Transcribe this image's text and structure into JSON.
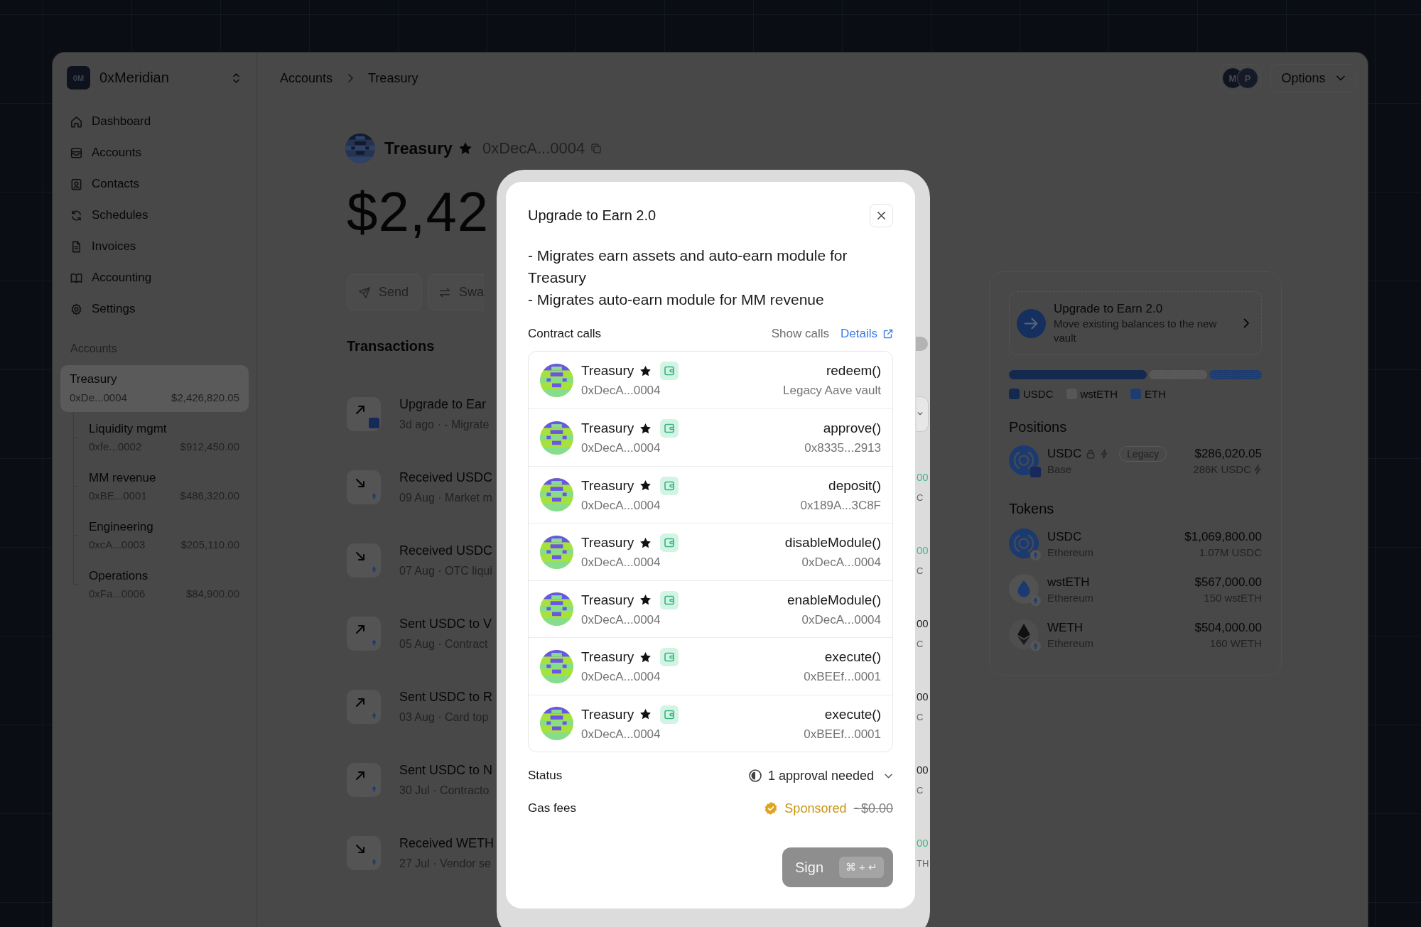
{
  "sidebar": {
    "logo": "0M",
    "org_name": "0xMeridian",
    "nav": [
      {
        "label": "Dashboard"
      },
      {
        "label": "Accounts"
      },
      {
        "label": "Contacts"
      },
      {
        "label": "Schedules"
      },
      {
        "label": "Invoices"
      },
      {
        "label": "Accounting"
      },
      {
        "label": "Settings"
      }
    ],
    "section_label": "Accounts",
    "accounts": [
      {
        "name": "Treasury",
        "address": "0xDe...0004",
        "balance": "$2,426,820.05",
        "selected": true,
        "children": [
          {
            "name": "Liquidity mgmt",
            "address": "0xfe...0002",
            "balance": "$912,450.00",
            "selected": false
          },
          {
            "name": "MM revenue",
            "address": "0xBE...0001",
            "balance": "$486,320.00",
            "selected": false
          },
          {
            "name": "Engineering",
            "address": "0xcA...0003",
            "balance": "$205,110.00",
            "selected": false
          },
          {
            "name": "Operations",
            "address": "0xFa...0006",
            "balance": "$84,900.00",
            "selected": false
          }
        ]
      }
    ]
  },
  "topbar": {
    "breadcrumbs": [
      "Accounts",
      "Treasury"
    ],
    "avatars": [
      "M",
      "P"
    ],
    "options": "Options"
  },
  "account": {
    "name": "Treasury",
    "starred": true,
    "address": "0xDecA...0004",
    "balance": "$2,42",
    "actions": [
      "Send",
      "Swa"
    ]
  },
  "transactions": {
    "title": "Transactions",
    "rows": [
      {
        "kind": "upgrade",
        "title": "Upgrade to Ear",
        "subtitle": "3d ago · - Migrate",
        "pending": true
      },
      {
        "kind": "received",
        "title": "Received USDC",
        "subtitle": "09 Aug · Market m",
        "pending": false,
        "amount": "00",
        "amount_sub": "C"
      },
      {
        "kind": "received",
        "title": "Received USDC",
        "subtitle": "07 Aug · OTC liqui",
        "pending": false,
        "amount": "00",
        "amount_sub": "C"
      },
      {
        "kind": "sent",
        "title": "Sent USDC to V",
        "subtitle": "05 Aug · Contract",
        "pending": false,
        "amount": "00",
        "amount_sub": "C"
      },
      {
        "kind": "sent",
        "title": "Sent USDC to R",
        "subtitle": "03 Aug · Card top",
        "pending": false,
        "amount": "00",
        "amount_sub": "C"
      },
      {
        "kind": "sent",
        "title": "Sent USDC to N",
        "subtitle": "30 Jul · Contracto",
        "pending": false,
        "amount": "00",
        "amount_sub": "C"
      },
      {
        "kind": "received",
        "title": "Received WETH",
        "subtitle": "27 Jul · Vendor se",
        "pending": false,
        "amount": "00",
        "amount_sub": "TH"
      }
    ]
  },
  "side_panel": {
    "banner": {
      "title": "Upgrade to Earn 2.0",
      "description": "Move existing balances to the new vault"
    },
    "legend": [
      {
        "label": "USDC",
        "color": "#13294f"
      },
      {
        "label": "wstETH",
        "color": "#575757"
      },
      {
        "label": "ETH",
        "color": "#1d3c70"
      }
    ],
    "positions": {
      "title": "Positions",
      "items": [
        {
          "kind": "usdc",
          "name": "USDC",
          "locked": true,
          "boosted": true,
          "tag": "Legacy",
          "network": "Base",
          "value": "$286,020.05",
          "amount": "286K USDC"
        }
      ]
    },
    "tokens": {
      "title": "Tokens",
      "items": [
        {
          "kind": "usdc",
          "name": "USDC",
          "network": "Ethereum",
          "value": "$1,069,800.00",
          "amount": "1.07M USDC"
        },
        {
          "kind": "wsteth",
          "name": "wstETH",
          "network": "Ethereum",
          "value": "$567,000.00",
          "amount": "150 wstETH"
        },
        {
          "kind": "eth",
          "name": "WETH",
          "network": "Ethereum",
          "value": "$504,000.00",
          "amount": "160 WETH"
        }
      ]
    }
  },
  "modal": {
    "title": "Upgrade to Earn 2.0",
    "description": [
      "- Migrates earn assets and auto-earn module for Treasury",
      "- Migrates auto-earn module for MM revenue"
    ],
    "calls_label": "Contract calls",
    "show_calls": "Show calls",
    "details": "Details",
    "calls": [
      {
        "account": "Treasury",
        "starred": true,
        "address": "0xDecA...0004",
        "method": "redeem()",
        "target": "Legacy Aave vault"
      },
      {
        "account": "Treasury",
        "starred": true,
        "address": "0xDecA...0004",
        "method": "approve()",
        "target": "0x8335...2913"
      },
      {
        "account": "Treasury",
        "starred": true,
        "address": "0xDecA...0004",
        "method": "deposit()",
        "target": "0x189A...3C8F"
      },
      {
        "account": "Treasury",
        "starred": true,
        "address": "0xDecA...0004",
        "method": "disableModule()",
        "target": "0xDecA...0004"
      },
      {
        "account": "Treasury",
        "starred": true,
        "address": "0xDecA...0004",
        "method": "enableModule()",
        "target": "0xDecA...0004"
      },
      {
        "account": "Treasury",
        "starred": true,
        "address": "0xDecA...0004",
        "method": "execute()",
        "target": "0xBEEf...0001"
      },
      {
        "account": "Treasury",
        "starred": true,
        "address": "0xDecA...0004",
        "method": "execute()",
        "target": "0xBEEf...0001"
      }
    ],
    "status": {
      "label": "Status",
      "value": "1 approval needed"
    },
    "gas": {
      "label": "Gas fees",
      "badge": "Sponsored",
      "fee": "~$0.00",
      "waived": true
    },
    "sign": {
      "label": "Sign",
      "shortcut": "⌘ + ↵",
      "disabled": true
    }
  }
}
